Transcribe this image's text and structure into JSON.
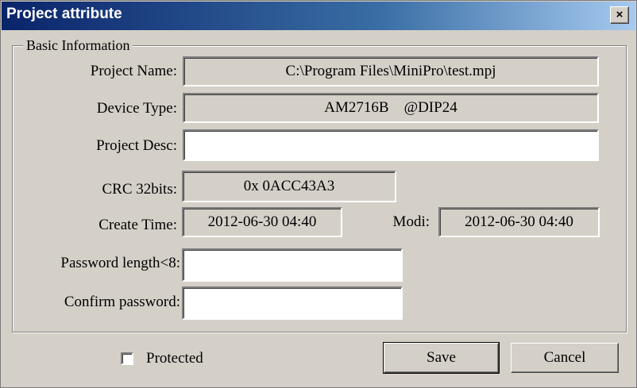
{
  "window": {
    "title": "Project attribute",
    "close_glyph": "×"
  },
  "group": {
    "legend": "Basic Information"
  },
  "fields": {
    "project_name": {
      "label": "Project Name:",
      "value": "C:\\Program Files\\MiniPro\\test.mpj"
    },
    "device_type": {
      "label": "Device Type:",
      "value": "AM2716B    @DIP24"
    },
    "project_desc": {
      "label": "Project Desc:",
      "value": ""
    },
    "crc": {
      "label": "CRC 32bits:",
      "value": "0x 0ACC43A3"
    },
    "create_time": {
      "label": "Create Time:",
      "value": "2012-06-30 04:40"
    },
    "modi": {
      "label": "Modi:",
      "value": "2012-06-30 04:40"
    },
    "password": {
      "label": "Password length<8:",
      "value": ""
    },
    "confirm_password": {
      "label": "Confirm password:",
      "value": ""
    }
  },
  "footer": {
    "protected_label": "Protected",
    "protected_checked": false,
    "save_label": "Save",
    "cancel_label": "Cancel"
  },
  "colors": {
    "face": "#d4d0c8",
    "title_start": "#0a246a",
    "title_end": "#a6caf0"
  },
  "icons": {
    "close": "close-icon",
    "checkbox": "checkbox-icon"
  }
}
